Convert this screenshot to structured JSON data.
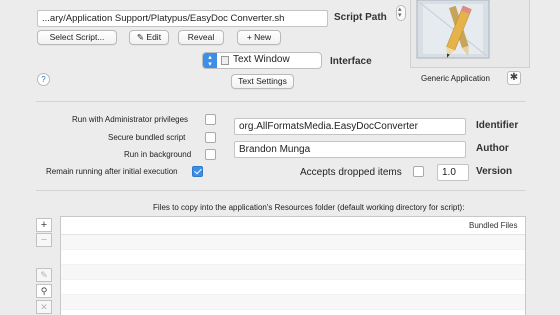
{
  "script": {
    "label": "Script Path",
    "path": "...ary/Application Support/Platypus/EasyDoc Converter.sh",
    "buttons": {
      "select": "Select Script...",
      "edit": "✎ Edit",
      "reveal": "Reveal",
      "new": "+ New"
    }
  },
  "interface": {
    "label": "Interface",
    "value": "Text Window",
    "settings_button": "Text Settings"
  },
  "icon": {
    "label": "Generic Application"
  },
  "help": "?",
  "options": [
    {
      "label": "Run with Administrator privileges",
      "checked": false
    },
    {
      "label": "Secure bundled script",
      "checked": false
    },
    {
      "label": "Run in background",
      "checked": false
    },
    {
      "label": "Remain running after initial execution",
      "checked": true
    }
  ],
  "identifier": {
    "label": "Identifier",
    "value": "org.AllFormatsMedia.EasyDocConverter"
  },
  "author": {
    "label": "Author",
    "value": "Brandon Munga"
  },
  "version": {
    "label": "Version",
    "value": "1.0"
  },
  "accepts": {
    "label": "Accepts dropped items",
    "checked": false
  },
  "files": {
    "caption": "Files to copy into the application's Resources folder (default working directory for script):",
    "header": "Bundled Files",
    "add": "+",
    "remove": "−"
  }
}
